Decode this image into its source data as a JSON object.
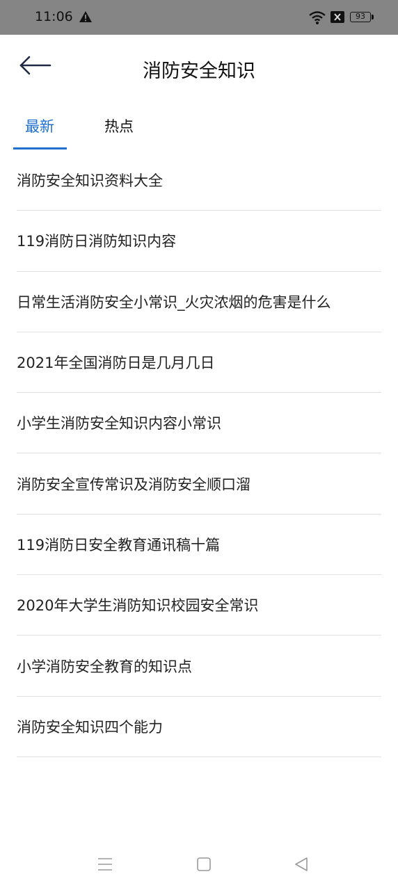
{
  "status_bar": {
    "time": "11:06",
    "battery": "93",
    "icons": [
      "warning-icon",
      "wifi-icon",
      "x-box-icon",
      "battery-icon"
    ]
  },
  "header": {
    "title": "消防安全知识",
    "back_icon": "arrow-left-icon"
  },
  "tabs": [
    {
      "label": "最新",
      "active": true
    },
    {
      "label": "热点",
      "active": false
    }
  ],
  "articles": [
    "消防安全知识资料大全",
    "119消防日消防知识内容",
    "日常生活消防安全小常识_火灾浓烟的危害是什么",
    "2021年全国消防日是几月几日",
    "小学生消防安全知识内容小常识",
    "消防安全宣传常识及消防安全顺口溜",
    "119消防日安全教育通讯稿十篇",
    "2020年大学生消防知识校园安全常识",
    "小学消防安全教育的知识点",
    "消防安全知识四个能力"
  ],
  "nav_bar": {
    "icons": [
      "menu-icon",
      "home-icon",
      "back-triangle-icon"
    ]
  },
  "colors": {
    "accent": "#1e6fd0",
    "status_bar_bg": "#858585",
    "divider": "#e2e2e2"
  }
}
